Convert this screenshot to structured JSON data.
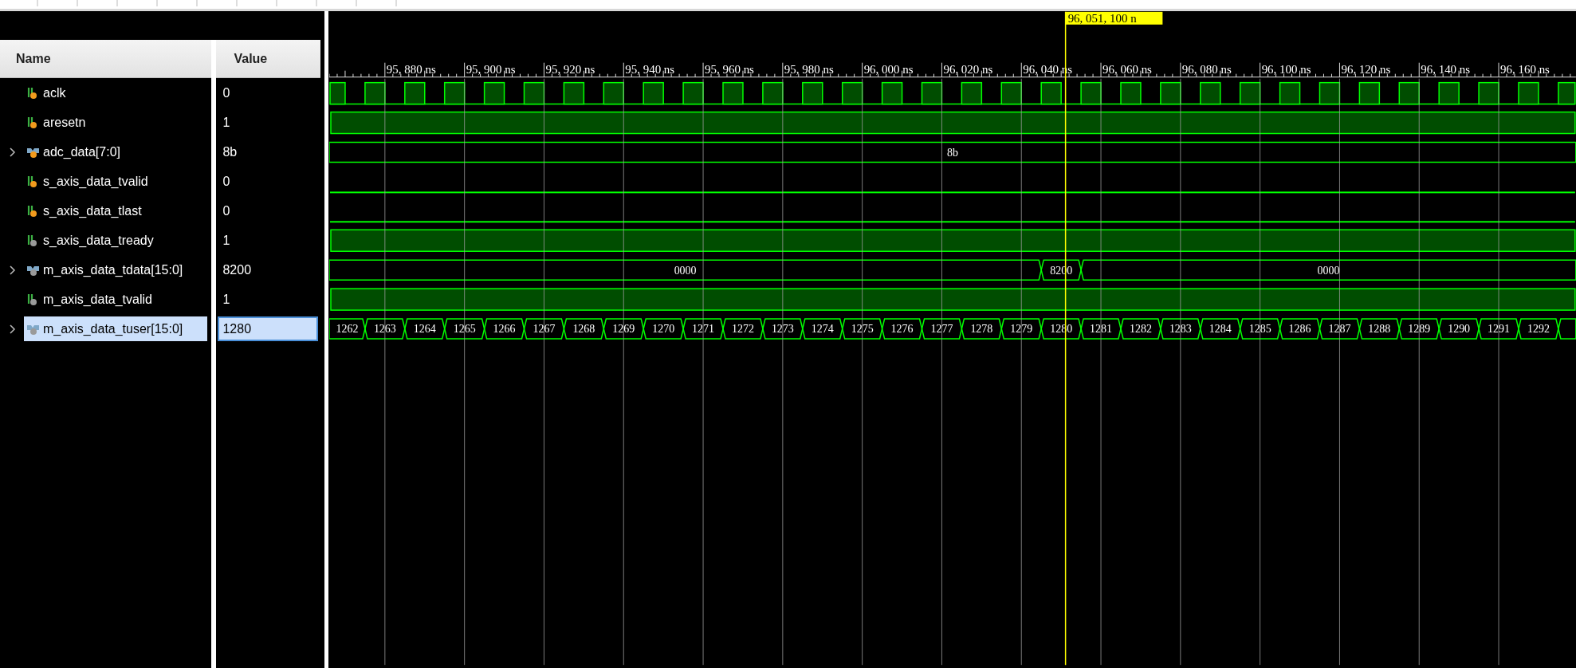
{
  "headers": {
    "name": "Name",
    "value": "Value"
  },
  "cursor": {
    "label": "96, 051, 100 n"
  },
  "timeline": {
    "ticks": [
      "95, 880 ns",
      "95, 900 ns",
      "95, 920 ns",
      "95, 940 ns",
      "95, 960 ns",
      "95, 980 ns",
      "96, 000 ns",
      "96, 020 ns",
      "96, 040 ns",
      "96, 060 ns",
      "96, 080 ns",
      "96, 100 ns",
      "96, 120 ns",
      "96, 140 ns",
      "96, 160 ns"
    ]
  },
  "signals": [
    {
      "name": "aclk",
      "kind": "clock",
      "output": false,
      "value": "0",
      "selected": false
    },
    {
      "name": "aresetn",
      "kind": "bit",
      "output": false,
      "value": "1",
      "high": true,
      "selected": false
    },
    {
      "name": "adc_data[7:0]",
      "kind": "bus",
      "output": false,
      "expanded": false,
      "value": "8b",
      "segments": [
        "8b"
      ],
      "selected": false
    },
    {
      "name": "s_axis_data_tvalid",
      "kind": "bit",
      "output": false,
      "value": "0",
      "high": false,
      "selected": false
    },
    {
      "name": "s_axis_data_tlast",
      "kind": "bit",
      "output": false,
      "value": "0",
      "high": false,
      "selected": false
    },
    {
      "name": "s_axis_data_tready",
      "kind": "bit",
      "output": true,
      "value": "1",
      "high": true,
      "selected": false
    },
    {
      "name": "m_axis_data_tdata[15:0]",
      "kind": "bus",
      "output": true,
      "expanded": false,
      "value": "8200",
      "segments": [
        "0000",
        "8200",
        "0000"
      ],
      "selected": false
    },
    {
      "name": "m_axis_data_tvalid",
      "kind": "bit",
      "output": true,
      "value": "1",
      "high": true,
      "selected": false
    },
    {
      "name": "m_axis_data_tuser[15:0]",
      "kind": "bus",
      "output": true,
      "expanded": false,
      "value": "1280",
      "segments": [
        "1262",
        "1263",
        "1264",
        "1265",
        "1266",
        "1267",
        "1268",
        "1269",
        "1270",
        "1271",
        "1272",
        "1273",
        "1274",
        "1275",
        "1276",
        "1277",
        "1278",
        "1279",
        "1280",
        "1281",
        "1282",
        "1283",
        "1284",
        "1285",
        "1286",
        "1287",
        "1288",
        "1289",
        "1290",
        "1291",
        "1292"
      ],
      "selected": true
    }
  ]
}
